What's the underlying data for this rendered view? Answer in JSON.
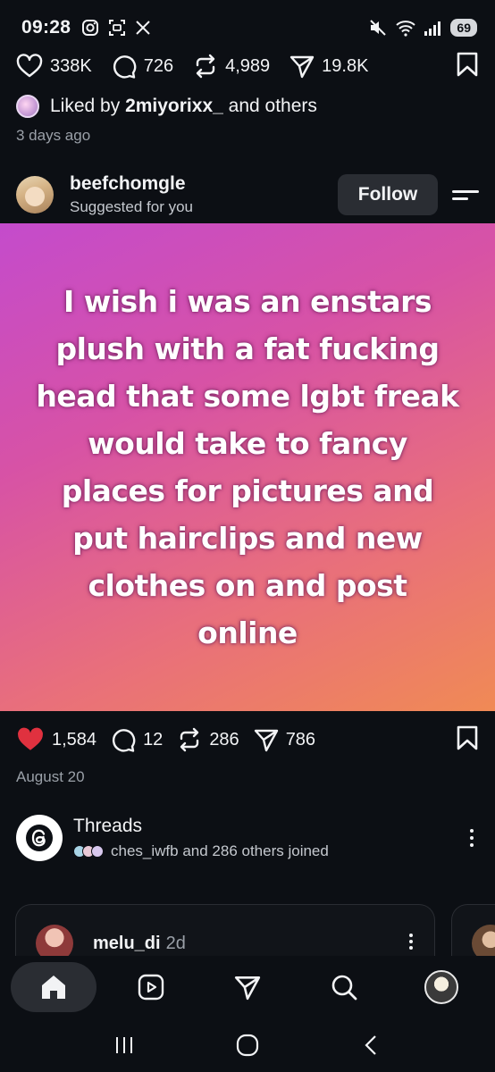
{
  "status_bar": {
    "time": "09:28",
    "battery": "69",
    "left_icons": [
      "instagram-icon",
      "screen-recorder-icon",
      "x-logo-icon"
    ],
    "right_icons": [
      "mute-icon",
      "wifi-icon",
      "signal-icon",
      "battery-icon"
    ]
  },
  "prev_post": {
    "likes": "338K",
    "comments": "726",
    "reposts": "4,989",
    "shares": "19.8K",
    "liked_by_prefix": "Liked by ",
    "liked_by_user": "2miyorixx_",
    "liked_by_suffix": " and others",
    "time_ago": "3 days ago"
  },
  "post": {
    "username": "beefchomgle",
    "subtitle": "Suggested for you",
    "follow_label": "Follow",
    "image_text": "I wish i was an enstars plush with a fat fucking head that some lgbt freak would take to fancy places for pictures and put hairclips and new clothes on and post online",
    "likes": "1,584",
    "comments": "12",
    "reposts": "286",
    "shares": "786",
    "date": "August 20",
    "like_color": "#e0313f"
  },
  "threads": {
    "title": "Threads",
    "subtitle": "ches_iwfb and 286 others joined"
  },
  "card": {
    "username": "melu_di",
    "time": "2d"
  },
  "bottom_nav": [
    "home-icon",
    "reels-icon",
    "direct-icon",
    "search-icon",
    "profile-avatar"
  ],
  "system_nav": [
    "recents-icon",
    "home-circle-icon",
    "back-icon"
  ]
}
